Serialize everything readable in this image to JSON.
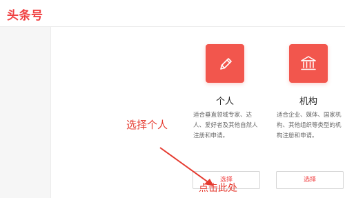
{
  "header": {
    "logo_text": "头条号"
  },
  "cards": [
    {
      "icon": "pencil-icon",
      "title": "个人",
      "description": "适合垂直领域专家、达人、爱好者及其他自然人注册和申请。",
      "button_label": "选择"
    },
    {
      "icon": "institution-icon",
      "title": "机构",
      "description": "适合企业、媒体、国家机构、其他组织等类型的机构注册和申请。",
      "button_label": "选择"
    }
  ],
  "annotations": {
    "select_person": "选择个人",
    "click_here": "点击此处",
    "color": "#e53a2f"
  },
  "colors": {
    "brand": "#f04142",
    "icon_bg": "#f2564d"
  }
}
